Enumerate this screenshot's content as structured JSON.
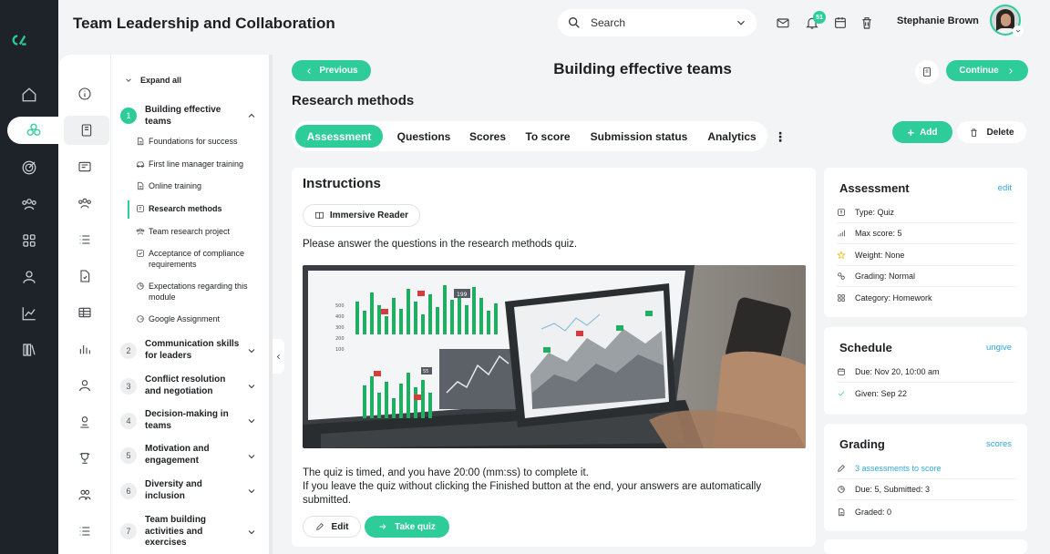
{
  "app": {
    "title": "Team Leadership and Collaboration"
  },
  "search": {
    "placeholder": "Search"
  },
  "notifications": {
    "count": "51"
  },
  "user": {
    "name": "Stephanie Brown"
  },
  "nav_rail": [
    "home",
    "modules",
    "goals",
    "people",
    "apps",
    "profile",
    "analytics",
    "library"
  ],
  "module_icons": [
    "info",
    "book",
    "media",
    "team",
    "list",
    "file",
    "table",
    "chart",
    "user",
    "award",
    "trophy",
    "group",
    "list-alt"
  ],
  "tree": {
    "expand_all": "Expand all",
    "modules": [
      {
        "num": "1",
        "title": "Building effective teams",
        "expanded": true
      },
      {
        "num": "2",
        "title": "Communication skills for leaders"
      },
      {
        "num": "3",
        "title": "Conflict resolution and negotiation"
      },
      {
        "num": "4",
        "title": "Decision-making in teams"
      },
      {
        "num": "5",
        "title": "Motivation and engagement"
      },
      {
        "num": "6",
        "title": "Diversity and inclusion"
      },
      {
        "num": "7",
        "title": "Team building activities and exercises"
      }
    ],
    "lessons": [
      {
        "label": "Foundations for success",
        "icon": "document-icon"
      },
      {
        "label": "First line manager training",
        "icon": "car-icon"
      },
      {
        "label": "Online training",
        "icon": "document-icon"
      },
      {
        "label": "Research methods",
        "icon": "quiz-icon",
        "active": true
      },
      {
        "label": "Team research project",
        "icon": "team-icon"
      },
      {
        "label": "Acceptance of compliance requirements",
        "icon": "checkbox-icon"
      },
      {
        "label": "Expectations regarding this module",
        "icon": "pie-icon"
      },
      {
        "label": "Google Assignment",
        "icon": "google-icon"
      }
    ]
  },
  "header": {
    "previous_label": "Previous",
    "continue_label": "Continue",
    "page_title": "Building effective teams",
    "section_title": "Research methods"
  },
  "tabs": [
    "Assessment",
    "Questions",
    "Scores",
    "To score",
    "Submission status",
    "Analytics"
  ],
  "actions": {
    "add_label": "Add",
    "delete_label": "Delete"
  },
  "instructions": {
    "title": "Instructions",
    "reader_label": "Immersive Reader",
    "intro": "Please answer the questions in the research methods quiz.",
    "timed": "The quiz is timed, and you have 20:00 (mm:ss) to complete it.",
    "leave": "If you leave the quiz without clicking the Finished button at the end, your answers are automatically submitted.",
    "edit_label": "Edit",
    "take_quiz_label": "Take quiz",
    "chart_labels": [
      "500",
      "400",
      "300",
      "200",
      "100",
      "199",
      "55"
    ]
  },
  "assessment": {
    "title": "Assessment",
    "link": "edit",
    "rows": [
      {
        "icon": "type-icon",
        "text": "Type: Quiz"
      },
      {
        "icon": "signal-icon",
        "text": "Max score: 5"
      },
      {
        "icon": "star-icon",
        "text": "Weight: None"
      },
      {
        "icon": "grading-icon",
        "text": "Grading: Normal"
      },
      {
        "icon": "category-icon",
        "text": "Category: Homework"
      }
    ]
  },
  "schedule": {
    "title": "Schedule",
    "link": "ungive",
    "rows": [
      {
        "icon": "calendar-icon",
        "text": "Due: Nov 20, 10:00 am"
      },
      {
        "icon": "check-icon",
        "text": "Given: Sep 22"
      }
    ]
  },
  "grading": {
    "title": "Grading",
    "link": "scores",
    "rows": [
      {
        "icon": "pencil-icon",
        "text": "3 assessments to score"
      },
      {
        "icon": "pie-icon",
        "text": "Due: 5, Submitted: 3"
      },
      {
        "icon": "document-icon",
        "text": "Graded: 0"
      }
    ]
  },
  "colors": {
    "accent": "#2ecc98",
    "rail": "#1d2328",
    "link": "#2fa6d8",
    "background": "#f2f4f5"
  }
}
